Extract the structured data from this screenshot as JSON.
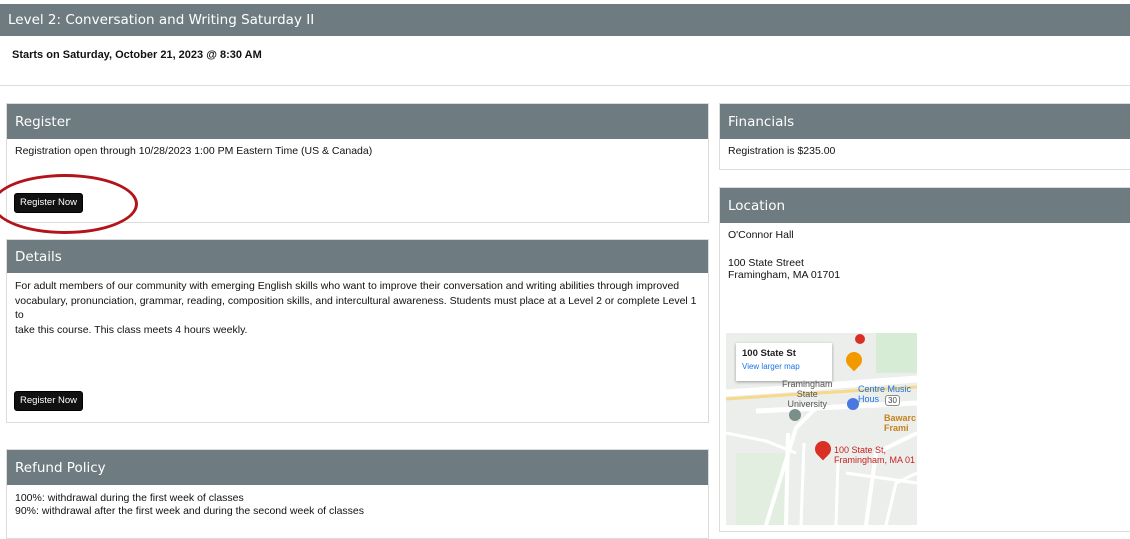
{
  "course": {
    "title": "Level 2: Conversation and Writing Saturday II",
    "start": "Starts on Saturday, October 21, 2023 @ 8:30 AM"
  },
  "register": {
    "header": "Register",
    "text": "Registration open through 10/28/2023 1:00 PM Eastern Time (US & Canada)",
    "button": "Register Now"
  },
  "details": {
    "header": "Details",
    "lines": [
      "For adult members of our community with emerging English skills who want to improve their conversation and writing abilities through improved",
      "vocabulary, pronunciation, grammar, reading, composition skills, and intercultural awareness. Students must place at a Level 2 or complete Level 1 to",
      "take this course. This class meets 4 hours weekly."
    ],
    "button": "Register Now"
  },
  "refund": {
    "header": "Refund Policy",
    "lines": [
      "100%: withdrawal during the first week of classes",
      "90%: withdrawal after the first week and during the second week of classes"
    ]
  },
  "financials": {
    "header": "Financials",
    "text": "Registration is $235.00"
  },
  "location": {
    "header": "Location",
    "name": "O'Connor Hall",
    "street": "100 State Street",
    "city": "Framingham, MA 01701",
    "map": {
      "card_title": "100 State St",
      "card_link": "View larger map",
      "pin_line1": "100 State St,",
      "pin_line2": "Framingham, MA 01",
      "poi_music": "Centre Music Hous",
      "poi_univ_1": "Framingham",
      "poi_univ_2": "State",
      "poi_univ_3": "University",
      "poi_bawa": "Bawarc",
      "poi_frami": "Frami",
      "road_route": "30"
    }
  },
  "colors": {
    "header_bg": "#6e7b80",
    "button_bg": "#111111",
    "highlight": "#b3141b",
    "map_pin": "#d93025",
    "map_link": "#1a73e8"
  }
}
